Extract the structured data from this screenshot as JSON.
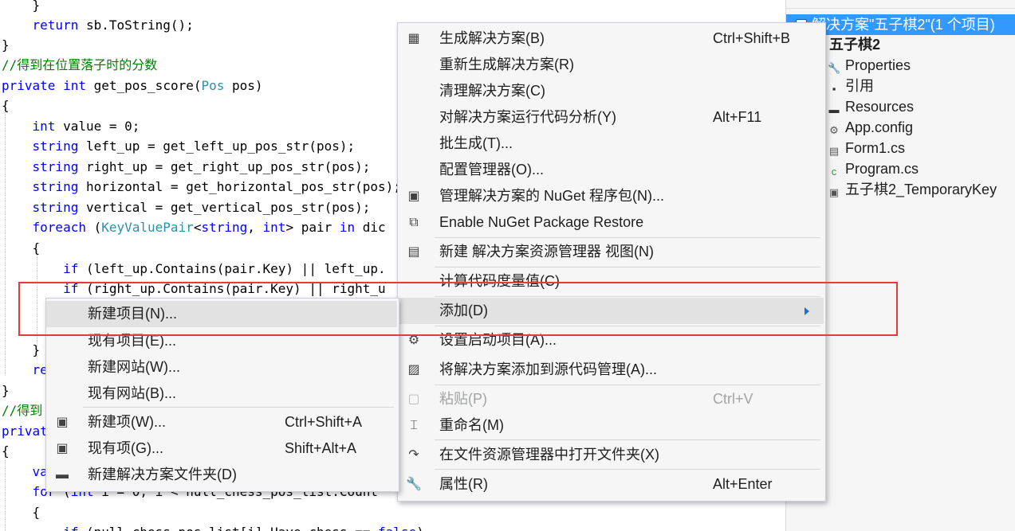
{
  "editor": {
    "code_lines": [
      {
        "segments": [
          {
            "t": "    }",
            "c": ""
          }
        ]
      },
      {
        "segments": [
          {
            "t": "    ",
            "c": ""
          },
          {
            "t": "return",
            "c": "kw"
          },
          {
            "t": " sb.ToString();",
            "c": ""
          }
        ]
      },
      {
        "segments": [
          {
            "t": "}",
            "c": ""
          }
        ]
      },
      {
        "segments": [
          {
            "t": "//得到在位置落子时的分数",
            "c": "cm"
          }
        ]
      },
      {
        "segments": [
          {
            "t": "private",
            "c": "kw"
          },
          {
            "t": " ",
            "c": ""
          },
          {
            "t": "int",
            "c": "kw"
          },
          {
            "t": " get_pos_score(",
            "c": ""
          },
          {
            "t": "Pos",
            "c": "ty"
          },
          {
            "t": " pos)",
            "c": ""
          }
        ]
      },
      {
        "segments": [
          {
            "t": "{",
            "c": ""
          }
        ]
      },
      {
        "segments": [
          {
            "t": "    ",
            "c": ""
          },
          {
            "t": "int",
            "c": "kw"
          },
          {
            "t": " value = 0;",
            "c": ""
          }
        ]
      },
      {
        "segments": [
          {
            "t": "    ",
            "c": ""
          },
          {
            "t": "string",
            "c": "kw"
          },
          {
            "t": " left_up = get_left_up_pos_str(pos);",
            "c": ""
          }
        ]
      },
      {
        "segments": [
          {
            "t": "    ",
            "c": ""
          },
          {
            "t": "string",
            "c": "kw"
          },
          {
            "t": " right_up = get_right_up_pos_str(pos);",
            "c": ""
          }
        ]
      },
      {
        "segments": [
          {
            "t": "    ",
            "c": ""
          },
          {
            "t": "string",
            "c": "kw"
          },
          {
            "t": " horizontal = get_horizontal_pos_str(pos);",
            "c": ""
          }
        ]
      },
      {
        "segments": [
          {
            "t": "    ",
            "c": ""
          },
          {
            "t": "string",
            "c": "kw"
          },
          {
            "t": " vertical = get_vertical_pos_str(pos);",
            "c": ""
          }
        ]
      },
      {
        "segments": [
          {
            "t": "    ",
            "c": ""
          },
          {
            "t": "foreach",
            "c": "kw"
          },
          {
            "t": " (",
            "c": ""
          },
          {
            "t": "KeyValuePair",
            "c": "ty"
          },
          {
            "t": "<",
            "c": ""
          },
          {
            "t": "string",
            "c": "kw"
          },
          {
            "t": ", ",
            "c": ""
          },
          {
            "t": "int",
            "c": "kw"
          },
          {
            "t": "> pair ",
            "c": ""
          },
          {
            "t": "in",
            "c": "kw"
          },
          {
            "t": " dic",
            "c": ""
          }
        ]
      },
      {
        "segments": [
          {
            "t": "    {",
            "c": ""
          }
        ]
      },
      {
        "segments": [
          {
            "t": "        ",
            "c": ""
          },
          {
            "t": "if",
            "c": "kw"
          },
          {
            "t": " (left_up.Contains(pair.Key) || left_up.",
            "c": ""
          }
        ]
      },
      {
        "segments": [
          {
            "t": "        ",
            "c": ""
          },
          {
            "t": "if",
            "c": "kw"
          },
          {
            "t": " (right_up.Contains(pair.Key) || right_u",
            "c": ""
          }
        ]
      },
      {
        "segments": [
          {
            "t": "",
            "c": ""
          }
        ]
      },
      {
        "segments": [
          {
            "t": "",
            "c": ""
          }
        ]
      },
      {
        "segments": [
          {
            "t": "    }",
            "c": ""
          }
        ]
      },
      {
        "segments": [
          {
            "t": "    ",
            "c": ""
          },
          {
            "t": "re",
            "c": "kw"
          }
        ]
      },
      {
        "segments": [
          {
            "t": "}",
            "c": ""
          }
        ]
      },
      {
        "segments": [
          {
            "t": "//得到",
            "c": "cm"
          }
        ]
      },
      {
        "segments": [
          {
            "t": "privat",
            "c": "kw"
          }
        ]
      },
      {
        "segments": [
          {
            "t": "{",
            "c": ""
          }
        ]
      },
      {
        "segments": [
          {
            "t": "    ",
            "c": ""
          },
          {
            "t": "va",
            "c": "kw"
          }
        ]
      },
      {
        "segments": [
          {
            "t": "    ",
            "c": ""
          },
          {
            "t": "for",
            "c": "kw"
          },
          {
            "t": " (",
            "c": ""
          },
          {
            "t": "int",
            "c": "kw"
          },
          {
            "t": " i = 0; i < null_chess_pos_list.Count",
            "c": ""
          }
        ]
      },
      {
        "segments": [
          {
            "t": "    {",
            "c": ""
          }
        ]
      },
      {
        "segments": [
          {
            "t": "        ",
            "c": ""
          },
          {
            "t": "if",
            "c": "kw"
          },
          {
            "t": " (null_chess_pos_list[i].Have_chess == ",
            "c": ""
          },
          {
            "t": "false",
            "c": "kw"
          },
          {
            "t": ")",
            "c": ""
          }
        ]
      }
    ]
  },
  "solution_explorer": {
    "solution_label": "解决方案\"五子棋2\"(1 个项目)",
    "project_label": "五子棋2",
    "items": [
      {
        "label": "Properties",
        "icon": "wrench-icon",
        "color": "#444444"
      },
      {
        "label": "引用",
        "icon": "references-icon",
        "color": "#333333"
      },
      {
        "label": "Resources",
        "icon": "folder-icon",
        "color": "#333333"
      },
      {
        "label": "App.config",
        "icon": "config-file-icon",
        "color": "#555555"
      },
      {
        "label": "Form1.cs",
        "icon": "form-icon",
        "color": "#555555"
      },
      {
        "label": "Program.cs",
        "icon": "csharp-file-icon",
        "color": "#2e9e3e"
      },
      {
        "label": "五子棋2_TemporaryKey",
        "icon": "key-file-icon",
        "color": "#555555"
      }
    ]
  },
  "context_menu": {
    "items": [
      {
        "label": "生成解决方案(B)",
        "shortcut": "Ctrl+Shift+B",
        "icon": "build-icon",
        "glyph": "▦"
      },
      {
        "label": "重新生成解决方案(R)",
        "shortcut": "",
        "icon": "",
        "glyph": ""
      },
      {
        "label": "清理解决方案(C)",
        "shortcut": "",
        "icon": "",
        "glyph": ""
      },
      {
        "label": "对解决方案运行代码分析(Y)",
        "shortcut": "Alt+F11",
        "icon": "",
        "glyph": ""
      },
      {
        "label": "批生成(T)...",
        "shortcut": "",
        "icon": "",
        "glyph": ""
      },
      {
        "label": "配置管理器(O)...",
        "shortcut": "",
        "icon": "",
        "glyph": ""
      },
      {
        "label": "管理解决方案的 NuGet 程序包(N)...",
        "shortcut": "",
        "icon": "nuget-icon",
        "glyph": "▣"
      },
      {
        "label": "Enable NuGet Package Restore",
        "shortcut": "",
        "icon": "package-restore-icon",
        "glyph": "⧉"
      },
      {
        "label": "新建 解决方案资源管理器 视图(N)",
        "shortcut": "",
        "icon": "new-view-icon",
        "glyph": "▤"
      },
      {
        "label": "计算代码度量值(C)",
        "shortcut": "",
        "icon": "",
        "glyph": ""
      },
      {
        "label": "添加(D)",
        "shortcut": "",
        "icon": "",
        "glyph": ""
      },
      {
        "label": "设置启动项目(A)...",
        "shortcut": "",
        "icon": "gear-icon",
        "glyph": "⚙"
      },
      {
        "label": "将解决方案添加到源代码管理(A)...",
        "shortcut": "",
        "icon": "source-control-icon",
        "glyph": "▨"
      },
      {
        "label": "粘贴(P)",
        "shortcut": "Ctrl+V",
        "icon": "paste-icon",
        "glyph": "▢"
      },
      {
        "label": "重命名(M)",
        "shortcut": "",
        "icon": "rename-icon",
        "glyph": "⌶"
      },
      {
        "label": "在文件资源管理器中打开文件夹(X)",
        "shortcut": "",
        "icon": "open-folder-icon",
        "glyph": "↷"
      },
      {
        "label": "属性(R)",
        "shortcut": "Alt+Enter",
        "icon": "wrench-icon",
        "glyph": "🔧"
      }
    ]
  },
  "add_submenu": {
    "items": [
      {
        "label": "新建项目(N)...",
        "shortcut": "",
        "icon": "",
        "glyph": ""
      },
      {
        "label": "现有项目(E)...",
        "shortcut": "",
        "icon": "",
        "glyph": ""
      },
      {
        "label": "新建网站(W)...",
        "shortcut": "",
        "icon": "",
        "glyph": ""
      },
      {
        "label": "现有网站(B)...",
        "shortcut": "",
        "icon": "",
        "glyph": ""
      },
      {
        "label": "新建项(W)...",
        "shortcut": "Ctrl+Shift+A",
        "icon": "new-item-icon",
        "glyph": "▣"
      },
      {
        "label": "现有项(G)...",
        "shortcut": "Shift+Alt+A",
        "icon": "existing-item-icon",
        "glyph": "▣"
      },
      {
        "label": "新建解决方案文件夹(D)",
        "shortcut": "",
        "icon": "new-folder-icon",
        "glyph": "▬"
      }
    ]
  },
  "colors": {
    "highlight_border": "#e8393d",
    "selection": "#3399ff",
    "submenu_arrow": "#1e6fd6"
  }
}
